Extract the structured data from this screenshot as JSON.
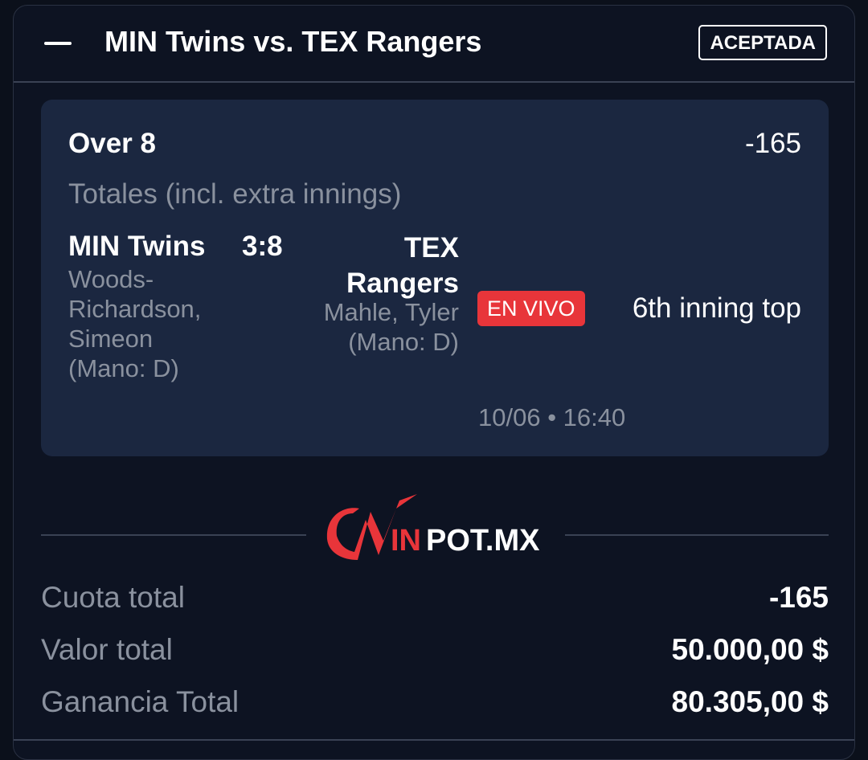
{
  "header": {
    "collapse_icon": "minus-icon",
    "match_title": "MIN Twins vs. TEX Rangers",
    "status": "ACEPTADA"
  },
  "bet": {
    "selection": "Over 8",
    "odds": "-165",
    "market": "Totales (incl. extra innings)",
    "home_team": "MIN Twins",
    "score": "3:8",
    "home_pitcher": "Woods-Richardson, Simeon (Mano: D)",
    "away_team": "TEX Rangers",
    "away_pitcher": "Mahle, Tyler (Mano: D)",
    "live_label": "EN VIVO",
    "inning": "6th inning top",
    "datetime": "10/06 • 16:40"
  },
  "logo": {
    "letter": "W",
    "text_accent": "IN",
    "text_main": "POT.MX",
    "accent_color": "#e8353a"
  },
  "summary": {
    "total_odds_label": "Cuota total",
    "total_odds_value": "-165",
    "total_stake_label": "Valor total",
    "total_stake_value": "50.000,00 $",
    "total_win_label": "Ganancia Total",
    "total_win_value": "80.305,00 $"
  },
  "colors": {
    "background": "#0b101b",
    "card": "#0d1322",
    "bet_box": "#1b2740",
    "muted_text": "#8a919e",
    "live": "#e8353a"
  }
}
